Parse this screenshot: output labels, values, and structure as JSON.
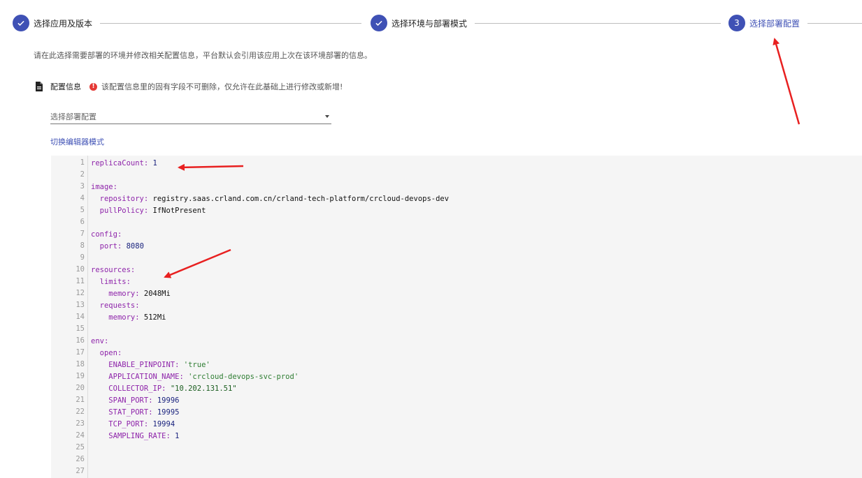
{
  "stepper": {
    "steps": [
      {
        "label": "选择应用及版本",
        "state": "done"
      },
      {
        "label": "选择环境与部署模式",
        "state": "done"
      },
      {
        "label": "选择部署配置",
        "state": "active",
        "number": "3"
      }
    ]
  },
  "description": "请在此选择需要部署的环境并修改相关配置信息，平台默认会引用该应用上次在该环境部署的信息。",
  "config_info": {
    "title": "配置信息",
    "warning": "该配置信息里的固有字段不可删除，仅允许在此基础上进行修改或新增!"
  },
  "select": {
    "placeholder": "选择部署配置"
  },
  "switch_editor": "切换编辑器模式",
  "editor": {
    "lines": [
      {
        "n": "1",
        "indent": "",
        "key": "replicaCount",
        "sep": ": ",
        "val": "1",
        "t": "n"
      },
      {
        "n": "2",
        "indent": "",
        "key": "",
        "sep": "",
        "val": "",
        "t": ""
      },
      {
        "n": "3",
        "indent": "",
        "key": "image",
        "sep": ":",
        "val": "",
        "t": ""
      },
      {
        "n": "4",
        "indent": "  ",
        "key": "repository",
        "sep": ": ",
        "val": "registry.saas.crland.com.cn/crland-tech-platform/crcloud-devops-dev",
        "t": "v"
      },
      {
        "n": "5",
        "indent": "  ",
        "key": "pullPolicy",
        "sep": ": ",
        "val": "IfNotPresent",
        "t": "v"
      },
      {
        "n": "6",
        "indent": "",
        "key": "",
        "sep": "",
        "val": "",
        "t": ""
      },
      {
        "n": "7",
        "indent": "",
        "key": "config",
        "sep": ":",
        "val": "",
        "t": ""
      },
      {
        "n": "8",
        "indent": "  ",
        "key": "port",
        "sep": ": ",
        "val": "8080",
        "t": "n"
      },
      {
        "n": "9",
        "indent": "",
        "key": "",
        "sep": "",
        "val": "",
        "t": ""
      },
      {
        "n": "10",
        "indent": "",
        "key": "resources",
        "sep": ":",
        "val": "",
        "t": ""
      },
      {
        "n": "11",
        "indent": "  ",
        "key": "limits",
        "sep": ":",
        "val": "",
        "t": ""
      },
      {
        "n": "12",
        "indent": "    ",
        "key": "memory",
        "sep": ": ",
        "val": "2048Mi",
        "t": "v"
      },
      {
        "n": "13",
        "indent": "  ",
        "key": "requests",
        "sep": ":",
        "val": "",
        "t": ""
      },
      {
        "n": "14",
        "indent": "    ",
        "key": "memory",
        "sep": ": ",
        "val": "512Mi",
        "t": "v"
      },
      {
        "n": "15",
        "indent": "",
        "key": "",
        "sep": "",
        "val": "",
        "t": ""
      },
      {
        "n": "16",
        "indent": "",
        "key": "env",
        "sep": ":",
        "val": "",
        "t": ""
      },
      {
        "n": "17",
        "indent": "  ",
        "key": "open",
        "sep": ":",
        "val": "",
        "t": ""
      },
      {
        "n": "18",
        "indent": "    ",
        "key": "ENABLE_PINPOINT",
        "sep": ": ",
        "val": "'true'",
        "t": "s"
      },
      {
        "n": "19",
        "indent": "    ",
        "key": "APPLICATION_NAME",
        "sep": ": ",
        "val": "'crcloud-devops-svc-prod'",
        "t": "s"
      },
      {
        "n": "20",
        "indent": "    ",
        "key": "COLLECTOR_IP",
        "sep": ": ",
        "val": "\"10.202.131.51\"",
        "t": "s2"
      },
      {
        "n": "21",
        "indent": "    ",
        "key": "SPAN_PORT",
        "sep": ": ",
        "val": "19996",
        "t": "n"
      },
      {
        "n": "22",
        "indent": "    ",
        "key": "STAT_PORT",
        "sep": ": ",
        "val": "19995",
        "t": "n"
      },
      {
        "n": "23",
        "indent": "    ",
        "key": "TCP_PORT",
        "sep": ": ",
        "val": "19994",
        "t": "n"
      },
      {
        "n": "24",
        "indent": "    ",
        "key": "SAMPLING_RATE",
        "sep": ": ",
        "val": "1",
        "t": "n"
      },
      {
        "n": "25",
        "indent": "",
        "key": "",
        "sep": "",
        "val": "",
        "t": ""
      },
      {
        "n": "26",
        "indent": "",
        "key": "",
        "sep": "",
        "val": "",
        "t": ""
      },
      {
        "n": "27",
        "indent": "",
        "key": "",
        "sep": "",
        "val": "",
        "t": ""
      }
    ]
  },
  "colors": {
    "accent": "#3f51b5",
    "annotation_arrow": "#e82020",
    "warning": "#e53935"
  }
}
